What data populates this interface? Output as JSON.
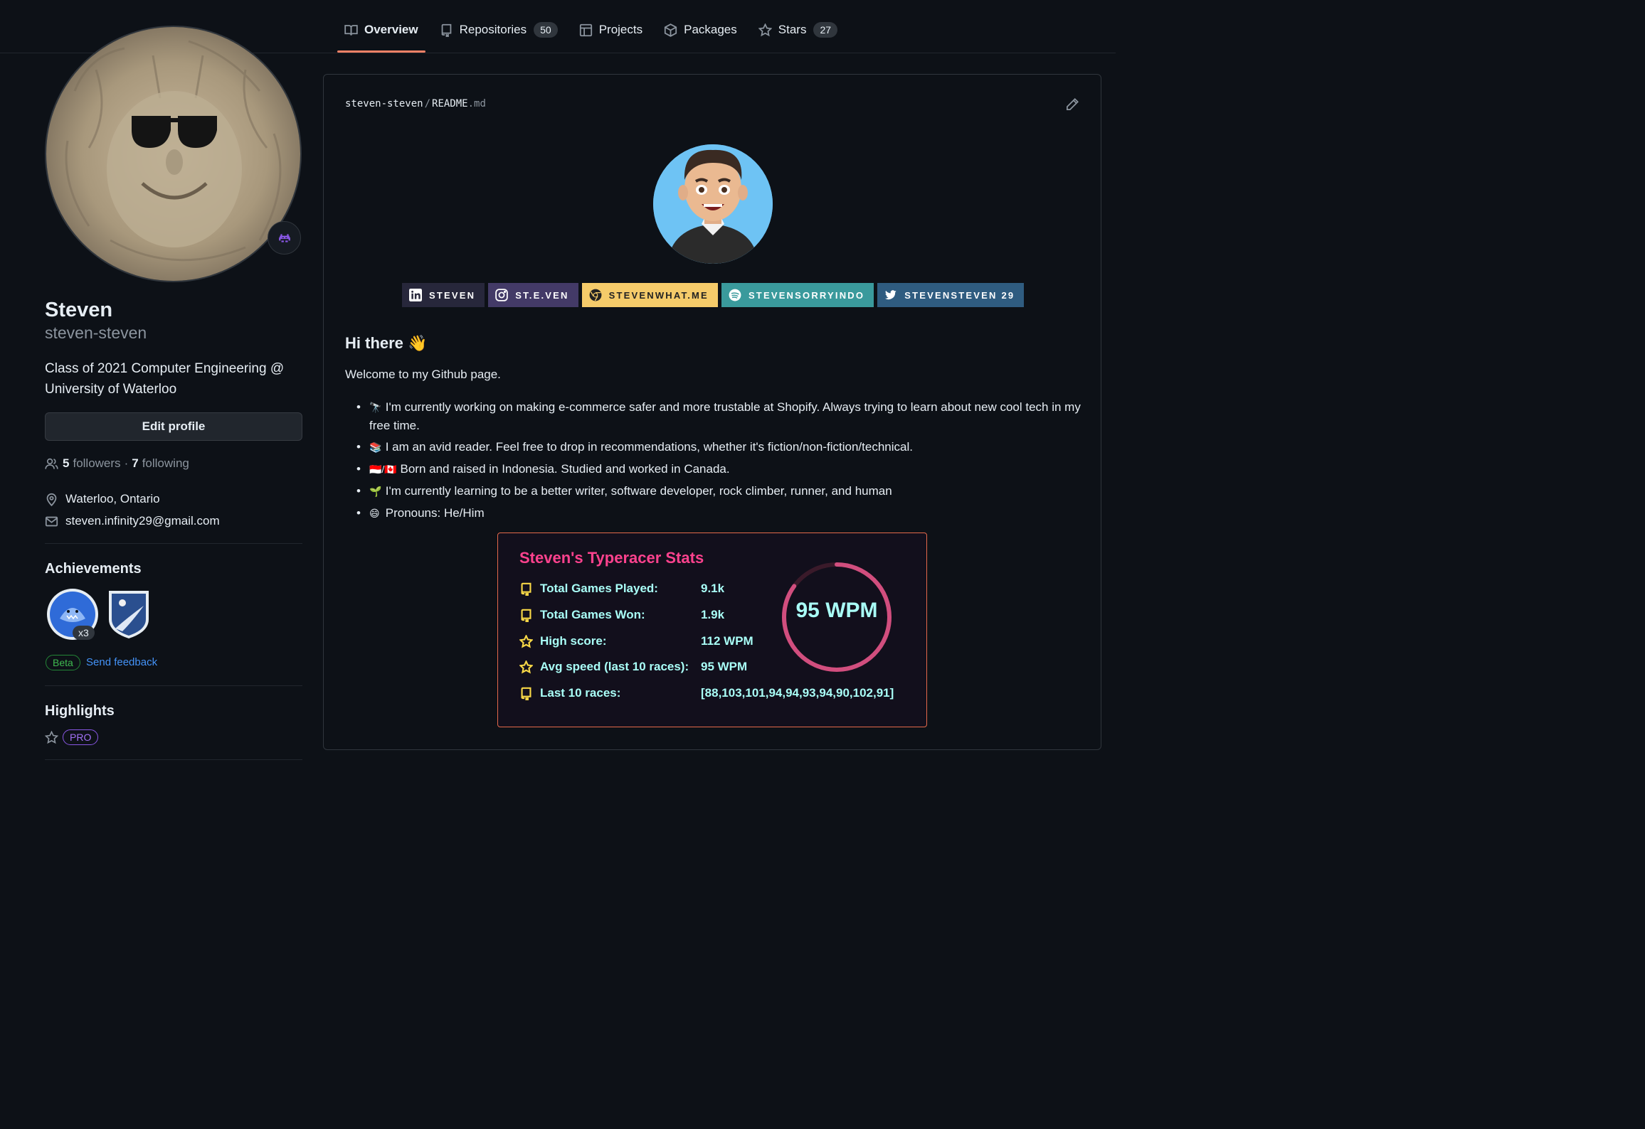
{
  "nav": {
    "tabs": [
      {
        "label": "Overview",
        "count": null
      },
      {
        "label": "Repositories",
        "count": "50"
      },
      {
        "label": "Projects",
        "count": null
      },
      {
        "label": "Packages",
        "count": null
      },
      {
        "label": "Stars",
        "count": "27"
      }
    ]
  },
  "profile": {
    "fullname": "Steven",
    "username": "steven-steven",
    "bio": "Class of 2021 Computer Engineering @ University of Waterloo",
    "edit_label": "Edit profile",
    "followers_count": "5",
    "followers_label": "followers",
    "following_count": "7",
    "following_label": "following",
    "separator": "·",
    "location": "Waterloo, Ontario",
    "email": "steven.infinity29@gmail.com",
    "achievements_title": "Achievements",
    "achievement_multiplier": "x3",
    "beta_label": "Beta",
    "feedback_label": "Send feedback",
    "highlights_title": "Highlights",
    "pro_label": "PRO"
  },
  "readme": {
    "path_owner": "steven-steven",
    "path_sep": "/",
    "path_file": "README",
    "path_ext": ".md",
    "socials": [
      {
        "label": "STEVEN",
        "icon": "linkedin-icon",
        "bg": "#27273b",
        "fg": "#ffffff"
      },
      {
        "label": "ST.E.VEN",
        "icon": "instagram-icon",
        "bg": "#433a67",
        "fg": "#ffffff"
      },
      {
        "label": "STEVENWHAT.ME",
        "icon": "chrome-icon",
        "bg": "#f5cb6a",
        "fg": "#222222"
      },
      {
        "label": "STEVENSORRYINDO",
        "icon": "spotify-icon",
        "bg": "#3a9a9c",
        "fg": "#ffffff"
      },
      {
        "label": "STEVENSTEVEN 29",
        "icon": "twitter-icon",
        "bg": "#2f5c80",
        "fg": "#ffffff"
      }
    ],
    "greeting": "Hi there 👋",
    "welcome": "Welcome to my Github page.",
    "bullets": [
      {
        "emoji": "🔭",
        "text": "I'm currently working on making e-commerce safer and more trustable at Shopify. Always trying to learn about new cool tech in my free time."
      },
      {
        "emoji": "📚",
        "text": "I am an avid reader. Feel free to drop in recommendations, whether it's fiction/non-fiction/technical."
      },
      {
        "emoji": "🇮🇩/🇨🇦",
        "text": "Born and raised in Indonesia. Studied and worked in Canada."
      },
      {
        "emoji": "🌱",
        "text": "I'm currently learning to be a better writer, software developer, rock climber, runner, and human"
      },
      {
        "emoji": "😄",
        "text": "Pronouns: He/Him"
      }
    ]
  },
  "typeracer": {
    "title": "Steven's Typeracer Stats",
    "rows": [
      {
        "icon": "repo-icon",
        "label": "Total Games Played:",
        "value": "9.1k"
      },
      {
        "icon": "repo-icon",
        "label": "Total Games Won:",
        "value": "1.9k"
      },
      {
        "icon": "star-icon",
        "label": "High score:",
        "value": "112 WPM"
      },
      {
        "icon": "star-icon",
        "label": "Avg speed (last 10 races):",
        "value": "95 WPM"
      },
      {
        "icon": "repo-icon",
        "label": "Last 10 races:",
        "value": "[88,103,101,94,94,93,94,90,102,91]"
      }
    ],
    "ring_text": "95 WPM",
    "ring_fraction": 0.85,
    "colors": {
      "title": "#fe428e",
      "text": "#a9fef7",
      "icon": "#f8d847",
      "ring": "#d14e7e",
      "border": "#e4694b"
    }
  }
}
